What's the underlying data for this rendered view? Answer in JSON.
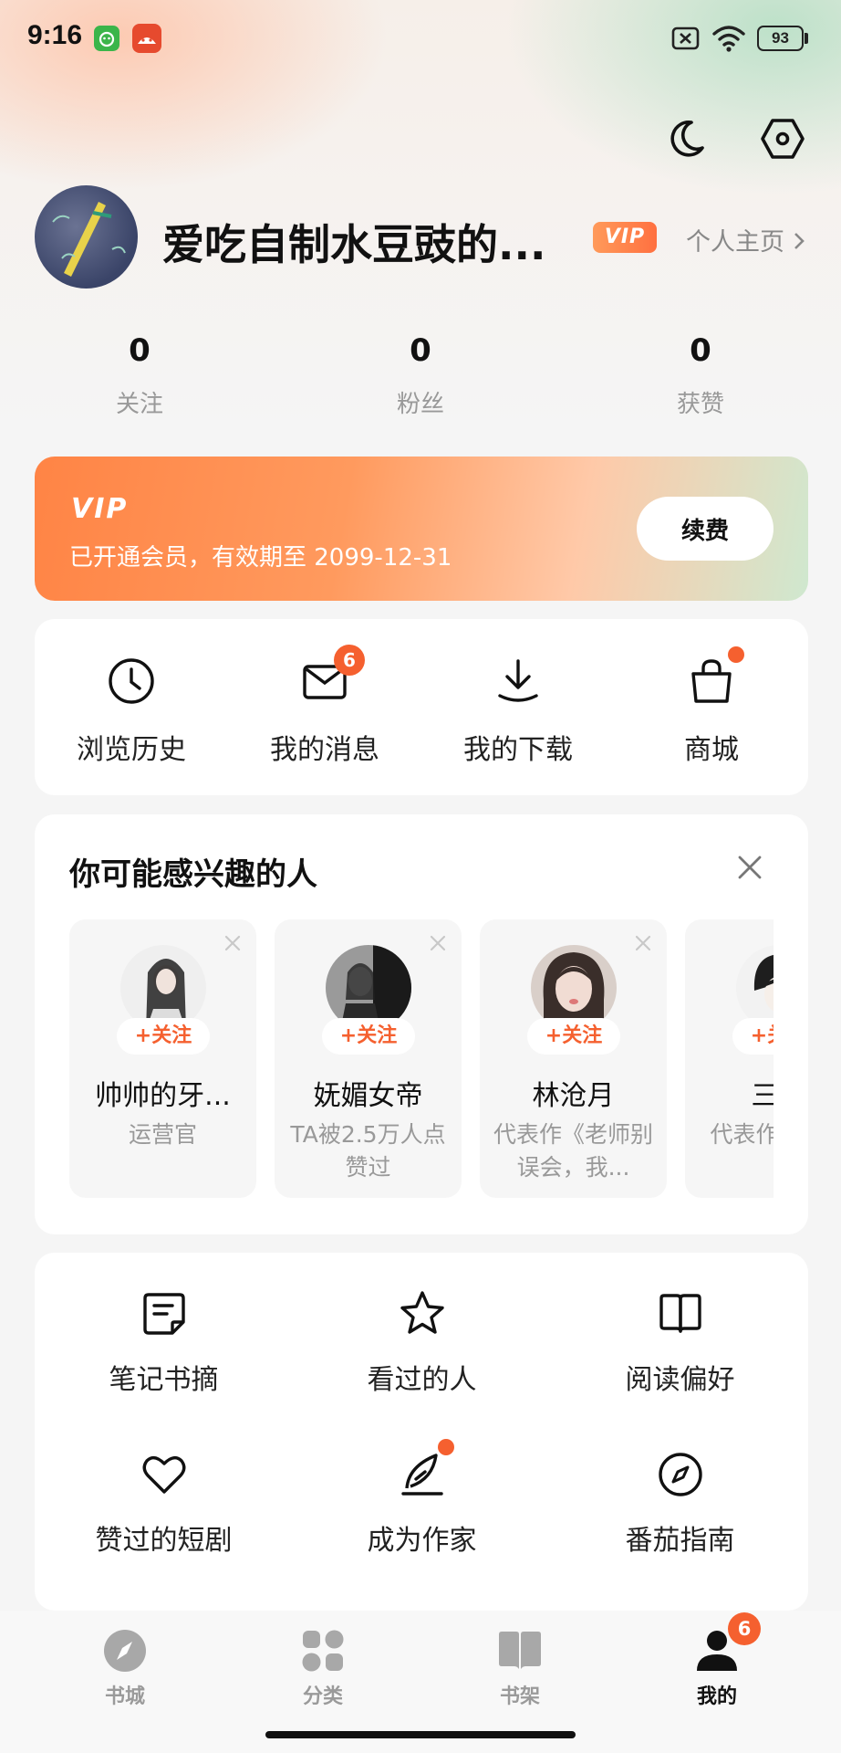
{
  "status_bar": {
    "time": "9:16",
    "battery": "93"
  },
  "profile": {
    "username": "爱吃自制水豆豉的...",
    "vip_badge": "VIP",
    "homepage_link": "个人主页",
    "stats": [
      {
        "value": "0",
        "label": "关注"
      },
      {
        "value": "0",
        "label": "粉丝"
      },
      {
        "value": "0",
        "label": "获赞"
      }
    ]
  },
  "vip_card": {
    "logo": "VIP",
    "expire_text": "已开通会员，有效期至 2099-12-31",
    "renew_button": "续费"
  },
  "quick_actions": [
    {
      "label": "浏览历史",
      "icon": "clock-icon"
    },
    {
      "label": "我的消息",
      "icon": "mail-icon",
      "badge": "6"
    },
    {
      "label": "我的下载",
      "icon": "download-icon"
    },
    {
      "label": "商城",
      "icon": "shopping-bag-icon",
      "dot": true
    }
  ],
  "suggestions": {
    "title": "你可能感兴趣的人",
    "follow_label": "+关注",
    "people": [
      {
        "name": "帅帅的牙...",
        "desc": "运营官"
      },
      {
        "name": "妩媚女帝",
        "desc": "TA被2.5万人点赞过"
      },
      {
        "name": "林沧月",
        "desc": "代表作《老师别误会，我..."
      },
      {
        "name": "三九",
        "desc": "代表作精神病"
      }
    ]
  },
  "features": [
    {
      "label": "笔记书摘",
      "icon": "note-icon"
    },
    {
      "label": "看过的人",
      "icon": "star-icon"
    },
    {
      "label": "阅读偏好",
      "icon": "book-icon"
    },
    {
      "label": "赞过的短剧",
      "icon": "heart-icon"
    },
    {
      "label": "成为作家",
      "icon": "quill-icon",
      "dot": true
    },
    {
      "label": "番茄指南",
      "icon": "compass-icon"
    }
  ],
  "bottom_nav": {
    "items": [
      {
        "label": "书城",
        "icon": "compass-nav-icon"
      },
      {
        "label": "分类",
        "icon": "category-icon"
      },
      {
        "label": "书架",
        "icon": "bookshelf-icon"
      },
      {
        "label": "我的",
        "icon": "person-icon",
        "active": true,
        "badge": "6"
      }
    ]
  },
  "colors": {
    "accent": "#f5602f",
    "vip_orange": "#ff8445"
  }
}
